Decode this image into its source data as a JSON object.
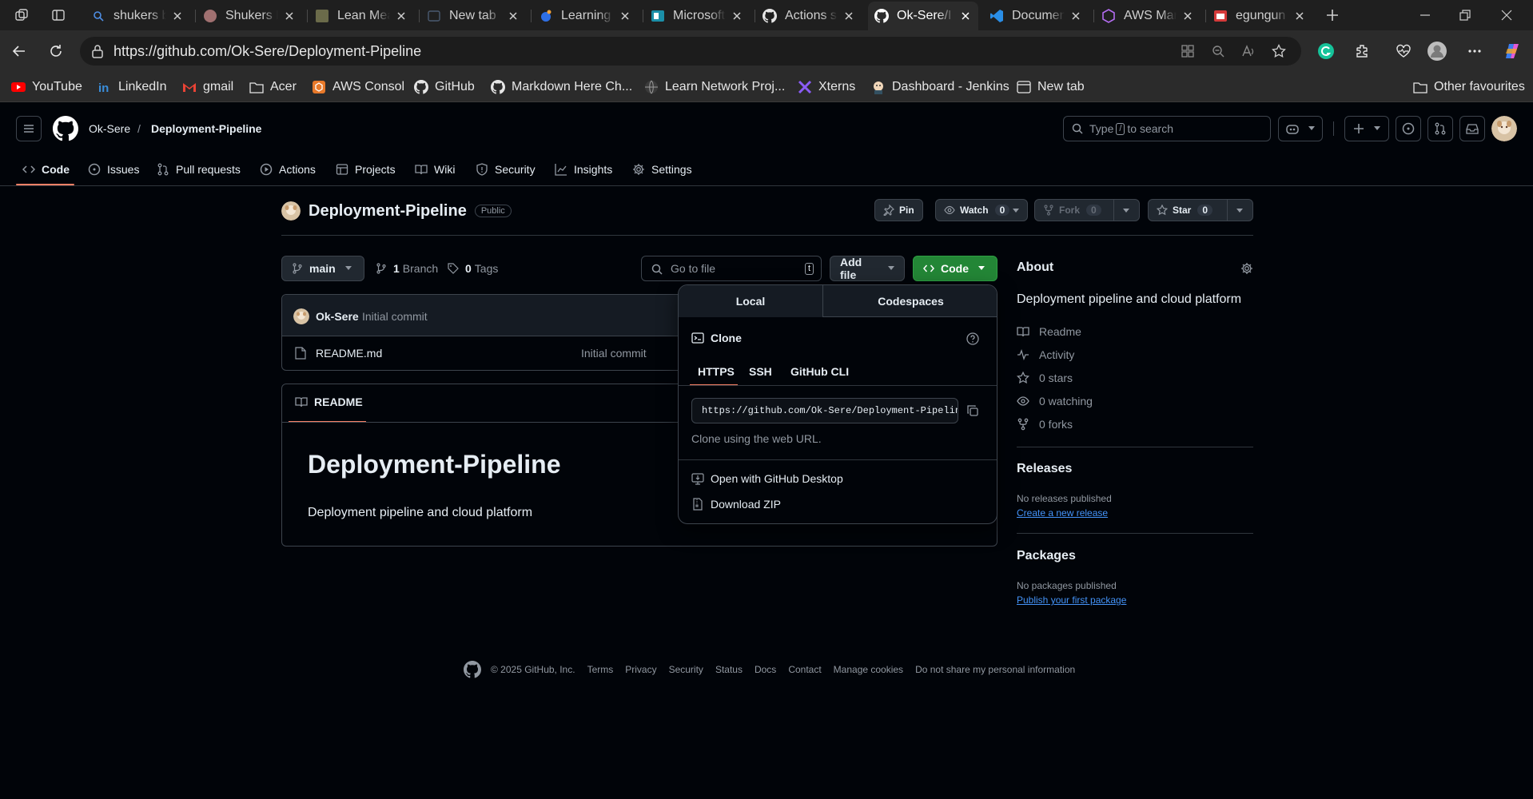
{
  "browser": {
    "tabs": [
      {
        "label": "shukers b",
        "favicon": "search-icon"
      },
      {
        "label": "Shukers N",
        "favicon": "avatar-icon"
      },
      {
        "label": "Lean Mea",
        "favicon": "page-icon"
      },
      {
        "label": "New tab",
        "favicon": "newtab-icon"
      },
      {
        "label": "Learning",
        "favicon": "learning-icon"
      },
      {
        "label": "Microsoft",
        "favicon": "microsoft-icon"
      },
      {
        "label": "Actions s",
        "favicon": "github-icon"
      },
      {
        "label": "Ok-Sere/I",
        "favicon": "github-icon",
        "active": true
      },
      {
        "label": "Documen",
        "favicon": "vscode-icon"
      },
      {
        "label": "AWS Man",
        "favicon": "aws-icon"
      },
      {
        "label": "egungun",
        "favicon": "calendar-icon"
      }
    ],
    "url": "https://github.com/Ok-Sere/Deployment-Pipeline",
    "favorites": [
      {
        "label": "YouTube",
        "icon": "youtube-icon"
      },
      {
        "label": "LinkedIn",
        "icon": "linkedin-icon"
      },
      {
        "label": "gmail",
        "icon": "gmail-icon"
      },
      {
        "label": "Acer",
        "icon": "folder-icon"
      },
      {
        "label": "AWS Consol",
        "icon": "aws-icon"
      },
      {
        "label": "GitHub",
        "icon": "github-icon"
      },
      {
        "label": "Markdown Here Ch...",
        "icon": "github-icon"
      },
      {
        "label": "Learn Network Proj...",
        "icon": "globe-icon"
      },
      {
        "label": "Xterns",
        "icon": "xterns-icon"
      },
      {
        "label": "Dashboard - Jenkins",
        "icon": "jenkins-icon"
      },
      {
        "label": "New tab",
        "icon": "newtab-icon"
      }
    ],
    "other_favourites": "Other favourites"
  },
  "header": {
    "owner": "Ok-Sere",
    "separator": "/",
    "repo": "Deployment-Pipeline",
    "search_prefix": "Type",
    "search_key": "/",
    "search_suffix": "to search"
  },
  "repo_nav": [
    {
      "label": "Code",
      "icon": "code-icon"
    },
    {
      "label": "Issues",
      "icon": "issue-icon"
    },
    {
      "label": "Pull requests",
      "icon": "pull-request-icon"
    },
    {
      "label": "Actions",
      "icon": "play-icon"
    },
    {
      "label": "Projects",
      "icon": "table-icon"
    },
    {
      "label": "Wiki",
      "icon": "book-icon"
    },
    {
      "label": "Security",
      "icon": "shield-icon"
    },
    {
      "label": "Insights",
      "icon": "graph-icon"
    },
    {
      "label": "Settings",
      "icon": "gear-icon"
    }
  ],
  "repo": {
    "name": "Deployment-Pipeline",
    "visibility": "Public",
    "pin_label": "Pin",
    "watch_label": "Watch",
    "watch_count": "0",
    "fork_label": "Fork",
    "fork_count": "0",
    "star_label": "Star",
    "star_count": "0"
  },
  "toolbar": {
    "branch": "main",
    "branch_count": "1",
    "branch_label": "Branch",
    "tag_count": "0",
    "tag_label": "Tags",
    "goto_placeholder": "Go to file",
    "goto_key": "t",
    "add_file": "Add file",
    "code": "Code"
  },
  "commit": {
    "author": "Ok-Sere",
    "message": "Initial commit"
  },
  "files": [
    {
      "name": "README.md",
      "message": "Initial commit"
    }
  ],
  "readme": {
    "tab": "README",
    "heading": "Deployment-Pipeline",
    "body": "Deployment pipeline and cloud platform"
  },
  "clone_popover": {
    "tabs": [
      "Local",
      "Codespaces"
    ],
    "clone_title": "Clone",
    "protocols": [
      "HTTPS",
      "SSH",
      "GitHub CLI"
    ],
    "clone_url": "https://github.com/Ok-Sere/Deployment-Pipeline.git",
    "hint": "Clone using the web URL.",
    "desktop": "Open with GitHub Desktop",
    "zip": "Download ZIP"
  },
  "about": {
    "title": "About",
    "description": "Deployment pipeline and cloud platform",
    "items": [
      {
        "label": "Readme",
        "icon": "book-icon"
      },
      {
        "label": "Activity",
        "icon": "pulse-icon"
      },
      {
        "label": "0 stars",
        "icon": "star-icon"
      },
      {
        "label": "0 watching",
        "icon": "eye-icon"
      },
      {
        "label": "0 forks",
        "icon": "fork-icon"
      }
    ]
  },
  "releases": {
    "title": "Releases",
    "empty": "No releases published",
    "link": "Create a new release"
  },
  "packages": {
    "title": "Packages",
    "empty": "No packages published",
    "link": "Publish your first package"
  },
  "footer": {
    "copyright": "© 2025 GitHub, Inc.",
    "links": [
      "Terms",
      "Privacy",
      "Security",
      "Status",
      "Docs",
      "Contact",
      "Manage cookies",
      "Do not share my personal information"
    ]
  },
  "colors": {
    "accent_green": "#238636",
    "tab_underline": "#f78166",
    "link_blue": "#4493f8",
    "page_bg": "#010409"
  }
}
